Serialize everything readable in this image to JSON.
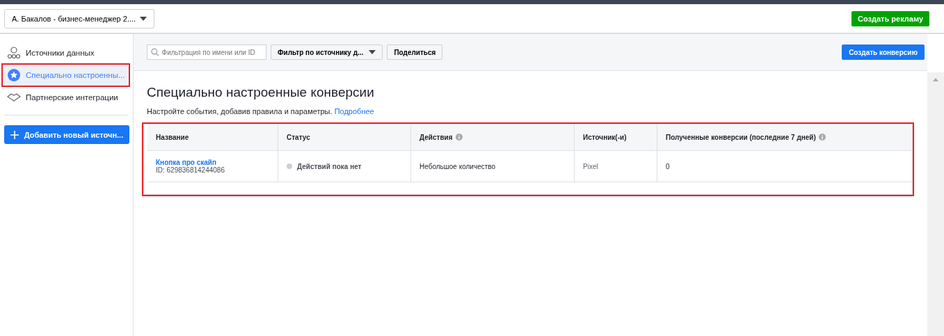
{
  "account_selector": {
    "value": "А. Бакалов - бизнес-менеджер 2...."
  },
  "create_ad_button": "Создать рекламу",
  "sidebar": {
    "items": [
      {
        "label": "Источники данных",
        "kind": "sources",
        "selected": false,
        "highlighted": false
      },
      {
        "label": "Специально настроенны...",
        "kind": "star",
        "selected": true,
        "highlighted": true
      },
      {
        "label": "Партнерские интеграции",
        "kind": "handshake",
        "selected": false,
        "highlighted": false
      }
    ],
    "add_button": "Добавить новый источн..."
  },
  "toolbar": {
    "search": {
      "placeholder": "Фильтрация по имени или ID"
    },
    "filter": "Фильтр по источнику д...",
    "share": "Поделиться",
    "create_button": "Создать конверсию"
  },
  "page": {
    "title": "Специально настроенные конверсии",
    "subtitle": "Настройте события, добавив правила и параметры.",
    "link": "Подробнее"
  },
  "table": {
    "highlighted": true,
    "columns": [
      {
        "label": "Название",
        "info": false
      },
      {
        "label": "Статус",
        "info": false
      },
      {
        "label": "Действия",
        "info": true
      },
      {
        "label": "Источник(-и)",
        "info": false
      },
      {
        "label": "Полученные конверсии (последние 7 дней)",
        "info": true
      }
    ],
    "rows": [
      {
        "name": "Кнопка про скайп",
        "id": "ID: 629836814244086",
        "status": "Действий пока нет",
        "color": "#ccd0d5",
        "actions": "Небольшое количество",
        "source": "Pixel",
        "conversions": "0"
      }
    ]
  }
}
